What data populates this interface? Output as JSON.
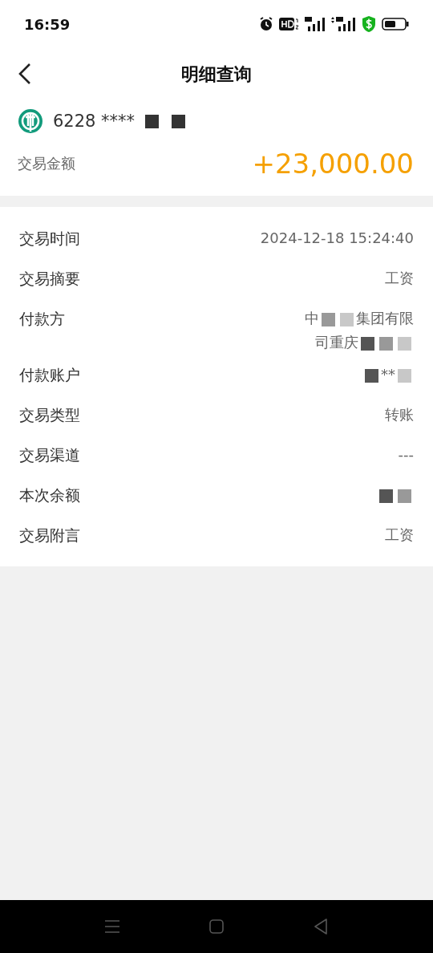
{
  "status_bar": {
    "time": "16:59"
  },
  "header": {
    "title": "明细查询"
  },
  "summary": {
    "card_number": [
      {
        "kind": "text",
        "text": "6228 ****"
      },
      {
        "kind": "mosaic"
      },
      {
        "kind": "mosaic"
      }
    ],
    "amount_label": "交易金额",
    "amount": "+23,000.00"
  },
  "details": [
    {
      "label": "交易时间",
      "value": [
        {
          "kind": "text",
          "text": "2024-12-18 15:24:40"
        }
      ]
    },
    {
      "label": "交易摘要",
      "value": [
        {
          "kind": "text",
          "text": "工资"
        }
      ]
    },
    {
      "label": "付款方",
      "value": [
        {
          "kind": "text",
          "text": "中"
        },
        {
          "kind": "mosaic"
        },
        {
          "kind": "mosaic"
        },
        {
          "kind": "text",
          "text": "集团有限"
        },
        {
          "kind": "break"
        },
        {
          "kind": "text",
          "text": "司重庆"
        },
        {
          "kind": "mosaic"
        },
        {
          "kind": "mosaic"
        },
        {
          "kind": "mosaic"
        }
      ]
    },
    {
      "label": "付款账户",
      "value": [
        {
          "kind": "mosaic"
        },
        {
          "kind": "text",
          "text": "**"
        },
        {
          "kind": "mosaic"
        }
      ]
    },
    {
      "label": "交易类型",
      "value": [
        {
          "kind": "text",
          "text": "转账"
        }
      ]
    },
    {
      "label": "交易渠道",
      "value": [
        {
          "kind": "text",
          "text": "---"
        }
      ]
    },
    {
      "label": "本次余额",
      "value": [
        {
          "kind": "mosaic"
        },
        {
          "kind": "mosaic"
        }
      ]
    },
    {
      "label": "交易附言",
      "value": [
        {
          "kind": "text",
          "text": "工资"
        }
      ]
    }
  ]
}
